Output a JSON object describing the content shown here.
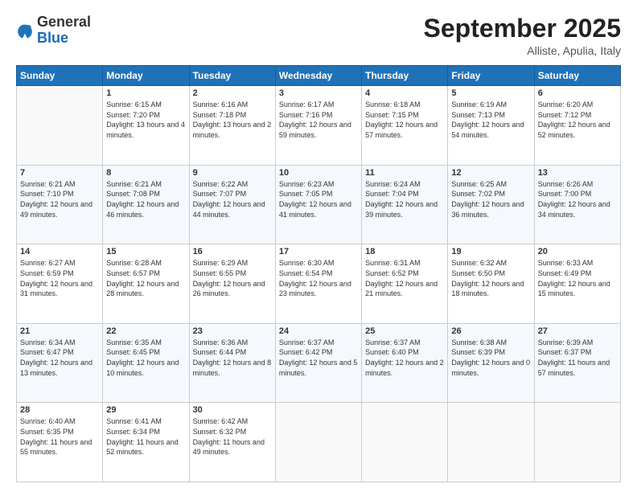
{
  "header": {
    "logo_general": "General",
    "logo_blue": "Blue",
    "month_title": "September 2025",
    "location": "Alliste, Apulia, Italy"
  },
  "weekdays": [
    "Sunday",
    "Monday",
    "Tuesday",
    "Wednesday",
    "Thursday",
    "Friday",
    "Saturday"
  ],
  "weeks": [
    [
      null,
      {
        "day": "1",
        "sunrise": "6:15 AM",
        "sunset": "7:20 PM",
        "daylight": "13 hours and 4 minutes."
      },
      {
        "day": "2",
        "sunrise": "6:16 AM",
        "sunset": "7:18 PM",
        "daylight": "13 hours and 2 minutes."
      },
      {
        "day": "3",
        "sunrise": "6:17 AM",
        "sunset": "7:16 PM",
        "daylight": "12 hours and 59 minutes."
      },
      {
        "day": "4",
        "sunrise": "6:18 AM",
        "sunset": "7:15 PM",
        "daylight": "12 hours and 57 minutes."
      },
      {
        "day": "5",
        "sunrise": "6:19 AM",
        "sunset": "7:13 PM",
        "daylight": "12 hours and 54 minutes."
      },
      {
        "day": "6",
        "sunrise": "6:20 AM",
        "sunset": "7:12 PM",
        "daylight": "12 hours and 52 minutes."
      }
    ],
    [
      {
        "day": "7",
        "sunrise": "6:21 AM",
        "sunset": "7:10 PM",
        "daylight": "12 hours and 49 minutes."
      },
      {
        "day": "8",
        "sunrise": "6:21 AM",
        "sunset": "7:08 PM",
        "daylight": "12 hours and 46 minutes."
      },
      {
        "day": "9",
        "sunrise": "6:22 AM",
        "sunset": "7:07 PM",
        "daylight": "12 hours and 44 minutes."
      },
      {
        "day": "10",
        "sunrise": "6:23 AM",
        "sunset": "7:05 PM",
        "daylight": "12 hours and 41 minutes."
      },
      {
        "day": "11",
        "sunrise": "6:24 AM",
        "sunset": "7:04 PM",
        "daylight": "12 hours and 39 minutes."
      },
      {
        "day": "12",
        "sunrise": "6:25 AM",
        "sunset": "7:02 PM",
        "daylight": "12 hours and 36 minutes."
      },
      {
        "day": "13",
        "sunrise": "6:26 AM",
        "sunset": "7:00 PM",
        "daylight": "12 hours and 34 minutes."
      }
    ],
    [
      {
        "day": "14",
        "sunrise": "6:27 AM",
        "sunset": "6:59 PM",
        "daylight": "12 hours and 31 minutes."
      },
      {
        "day": "15",
        "sunrise": "6:28 AM",
        "sunset": "6:57 PM",
        "daylight": "12 hours and 28 minutes."
      },
      {
        "day": "16",
        "sunrise": "6:29 AM",
        "sunset": "6:55 PM",
        "daylight": "12 hours and 26 minutes."
      },
      {
        "day": "17",
        "sunrise": "6:30 AM",
        "sunset": "6:54 PM",
        "daylight": "12 hours and 23 minutes."
      },
      {
        "day": "18",
        "sunrise": "6:31 AM",
        "sunset": "6:52 PM",
        "daylight": "12 hours and 21 minutes."
      },
      {
        "day": "19",
        "sunrise": "6:32 AM",
        "sunset": "6:50 PM",
        "daylight": "12 hours and 18 minutes."
      },
      {
        "day": "20",
        "sunrise": "6:33 AM",
        "sunset": "6:49 PM",
        "daylight": "12 hours and 15 minutes."
      }
    ],
    [
      {
        "day": "21",
        "sunrise": "6:34 AM",
        "sunset": "6:47 PM",
        "daylight": "12 hours and 13 minutes."
      },
      {
        "day": "22",
        "sunrise": "6:35 AM",
        "sunset": "6:45 PM",
        "daylight": "12 hours and 10 minutes."
      },
      {
        "day": "23",
        "sunrise": "6:36 AM",
        "sunset": "6:44 PM",
        "daylight": "12 hours and 8 minutes."
      },
      {
        "day": "24",
        "sunrise": "6:37 AM",
        "sunset": "6:42 PM",
        "daylight": "12 hours and 5 minutes."
      },
      {
        "day": "25",
        "sunrise": "6:37 AM",
        "sunset": "6:40 PM",
        "daylight": "12 hours and 2 minutes."
      },
      {
        "day": "26",
        "sunrise": "6:38 AM",
        "sunset": "6:39 PM",
        "daylight": "12 hours and 0 minutes."
      },
      {
        "day": "27",
        "sunrise": "6:39 AM",
        "sunset": "6:37 PM",
        "daylight": "11 hours and 57 minutes."
      }
    ],
    [
      {
        "day": "28",
        "sunrise": "6:40 AM",
        "sunset": "6:35 PM",
        "daylight": "11 hours and 55 minutes."
      },
      {
        "day": "29",
        "sunrise": "6:41 AM",
        "sunset": "6:34 PM",
        "daylight": "11 hours and 52 minutes."
      },
      {
        "day": "30",
        "sunrise": "6:42 AM",
        "sunset": "6:32 PM",
        "daylight": "11 hours and 49 minutes."
      },
      null,
      null,
      null,
      null
    ]
  ]
}
